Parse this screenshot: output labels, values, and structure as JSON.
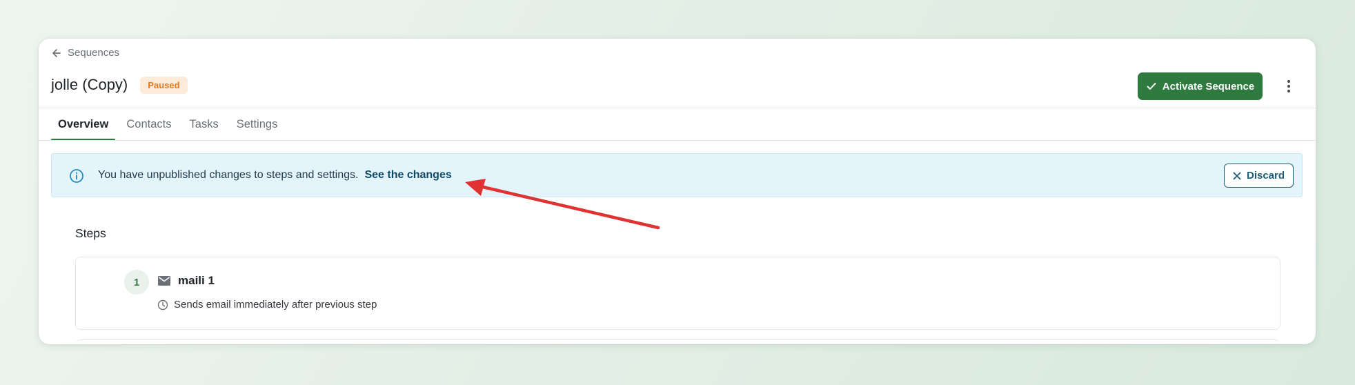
{
  "breadcrumb": {
    "label": "Sequences",
    "icon": "arrow-left-icon"
  },
  "header": {
    "title": "jolle (Copy)",
    "status": "Paused",
    "activate_label": "Activate Sequence",
    "more_icon": "more-vertical-icon"
  },
  "tabs": [
    {
      "label": "Overview",
      "active": true
    },
    {
      "label": "Contacts",
      "active": false
    },
    {
      "label": "Tasks",
      "active": false
    },
    {
      "label": "Settings",
      "active": false
    }
  ],
  "banner": {
    "icon": "info-icon",
    "message": "You have unpublished changes to steps and settings.",
    "link_label": "See the changes",
    "discard_label": "Discard"
  },
  "steps": {
    "heading": "Steps",
    "items": [
      {
        "number": "1",
        "icon": "mail-icon",
        "title": "maili 1",
        "timing_icon": "clock-icon",
        "timing": "Sends email immediately after previous step"
      }
    ]
  },
  "colors": {
    "accent_green": "#2f7a3e",
    "paused_badge_bg": "#fdebd9",
    "paused_badge_text": "#e07a1f",
    "banner_bg": "#e4f4fb",
    "annotation_arrow": "#e03232"
  }
}
